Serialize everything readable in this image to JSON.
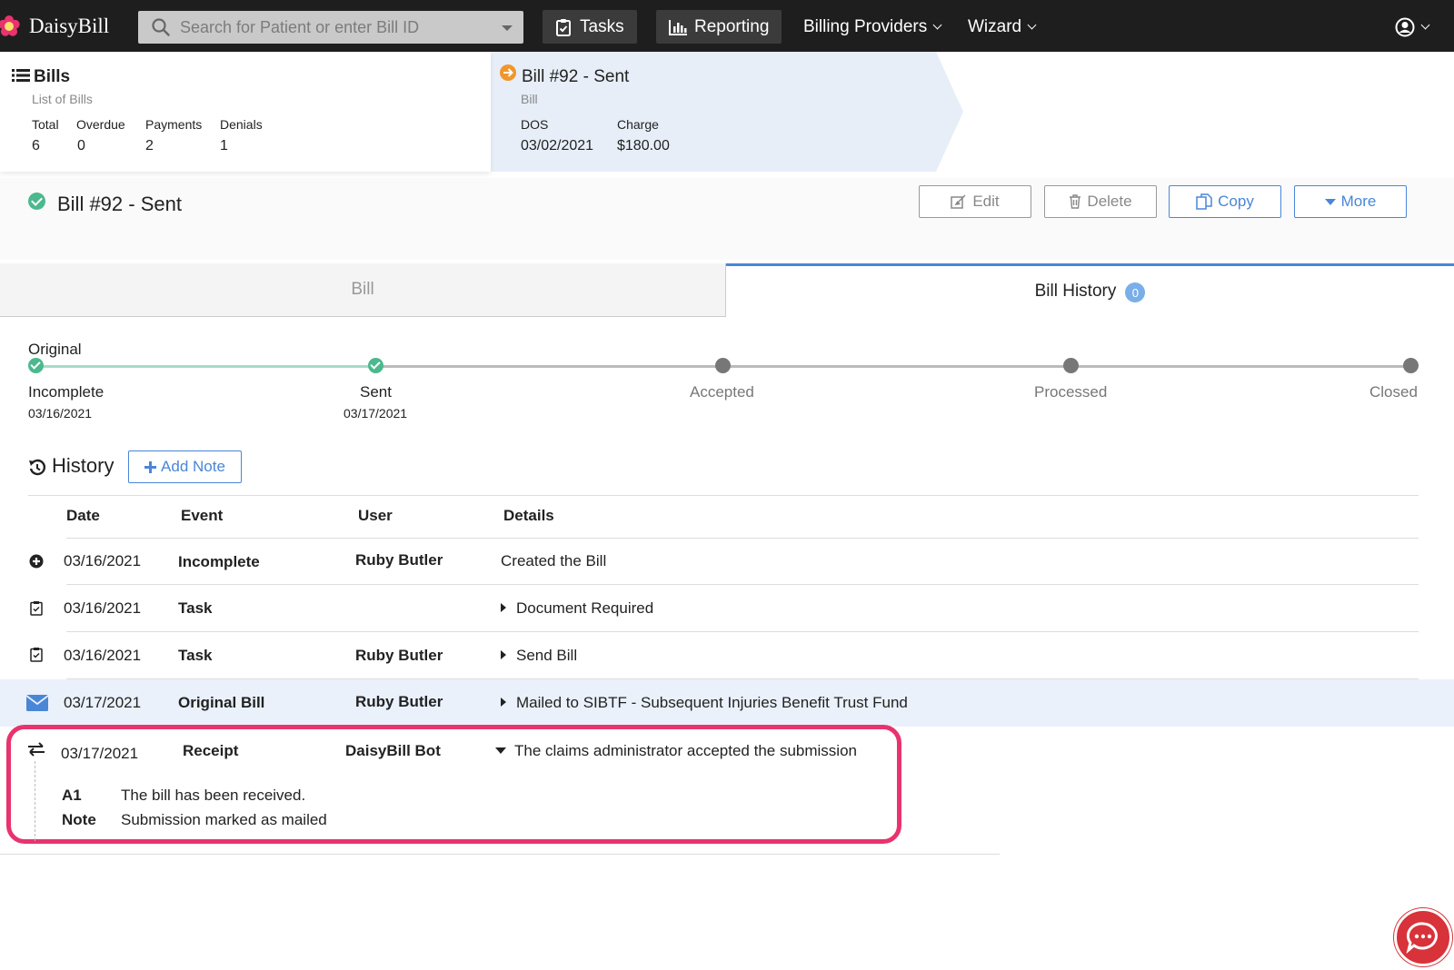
{
  "nav": {
    "brand": "DaisyBill",
    "search_placeholder": "Search for Patient or enter Bill ID",
    "tasks": "Tasks",
    "reporting": "Reporting",
    "billing_providers": "Billing Providers",
    "wizard": "Wizard"
  },
  "crumbs": {
    "bills": {
      "title": "Bills",
      "subtitle": "List of Bills",
      "stats": [
        {
          "label": "Total",
          "value": "6"
        },
        {
          "label": "Overdue",
          "value": "0"
        },
        {
          "label": "Payments",
          "value": "2"
        },
        {
          "label": "Denials",
          "value": "1"
        }
      ]
    },
    "bill": {
      "title": "Bill #92 - Sent",
      "subtitle": "Bill",
      "stats": [
        {
          "label": "DOS",
          "value": "03/02/2021"
        },
        {
          "label": "Charge",
          "value": "$180.00"
        }
      ]
    }
  },
  "bill_header": {
    "title": "Bill #92 - Sent",
    "edit": "Edit",
    "delete": "Delete",
    "copy": "Copy",
    "more": "More"
  },
  "tabs": {
    "bill": "Bill",
    "history": "Bill History",
    "history_count": "0"
  },
  "timeline": {
    "label": "Original",
    "steps": [
      {
        "name": "Incomplete",
        "date": "03/16/2021",
        "done": true
      },
      {
        "name": "Sent",
        "date": "03/17/2021",
        "done": true
      },
      {
        "name": "Accepted",
        "date": "",
        "done": false
      },
      {
        "name": "Processed",
        "date": "",
        "done": false
      },
      {
        "name": "Closed",
        "date": "",
        "done": false
      }
    ]
  },
  "history": {
    "title": "History",
    "add_note": "Add Note",
    "columns": [
      "Date",
      "Event",
      "User",
      "Details"
    ],
    "rows": [
      {
        "icon": "plus-circle-icon",
        "date": "03/16/2021",
        "event": "Incomplete",
        "user": "Ruby Butler",
        "details": "Created the Bill"
      },
      {
        "icon": "clipboard-check-icon",
        "date": "03/16/2021",
        "event": "Task",
        "user": "",
        "details": "Document Required"
      },
      {
        "icon": "clipboard-check-icon",
        "date": "03/16/2021",
        "event": "Task",
        "user": "Ruby Butler",
        "details": "Send Bill"
      },
      {
        "icon": "envelope-icon",
        "date": "03/17/2021",
        "event": "Original Bill",
        "user": "Ruby Butler",
        "details": "Mailed to SIBTF - Subsequent Injuries Benefit Trust Fund"
      },
      {
        "icon": "exchange-icon",
        "date": "03/17/2021",
        "event": "Receipt",
        "user": "DaisyBill Bot",
        "details": "The claims administrator accepted the submission"
      }
    ],
    "receipt_details": [
      {
        "label": "A1",
        "text": "The bill has been received."
      },
      {
        "label": "Note",
        "text": "Submission marked as mailed"
      }
    ]
  },
  "colors": {
    "nav_bg": "#1e1e1e",
    "accent_blue": "#4a86d8",
    "success_green": "#4cb88e",
    "highlight_pink": "#e8336e",
    "chat_red": "#d8323a"
  }
}
